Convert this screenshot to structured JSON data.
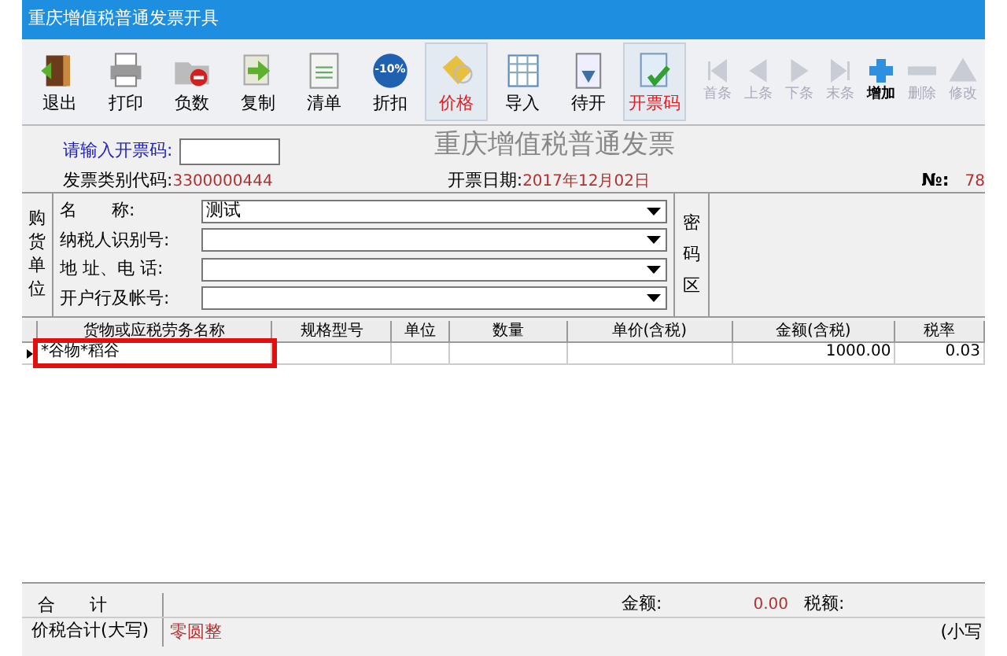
{
  "window": {
    "title": "重庆增值税普通发票开具"
  },
  "toolbar": [
    {
      "label": "退出",
      "kind": "exit",
      "active": false,
      "disabled": false
    },
    {
      "label": "打印",
      "kind": "print",
      "active": false,
      "disabled": false
    },
    {
      "label": "负数",
      "kind": "negative",
      "active": false,
      "disabled": false
    },
    {
      "label": "复制",
      "kind": "copy",
      "active": false,
      "disabled": false
    },
    {
      "label": "清单",
      "kind": "list",
      "active": false,
      "disabled": false
    },
    {
      "label": "折扣",
      "kind": "discount",
      "icon_text": "-10%",
      "active": false,
      "disabled": false
    },
    {
      "label": "价格",
      "kind": "price",
      "active": true,
      "disabled": false
    },
    {
      "label": "导入",
      "kind": "import",
      "active": false,
      "disabled": false
    },
    {
      "label": "待开",
      "kind": "pending",
      "active": false,
      "disabled": false
    },
    {
      "label": "开票码",
      "kind": "code",
      "active": true,
      "disabled": false
    }
  ],
  "nav": [
    {
      "label": "首条",
      "kind": "first",
      "disabled": true
    },
    {
      "label": "上条",
      "kind": "prev",
      "disabled": true
    },
    {
      "label": "下条",
      "kind": "next",
      "disabled": true
    },
    {
      "label": "末条",
      "kind": "last",
      "disabled": true
    },
    {
      "label": "增加",
      "kind": "add",
      "disabled": false
    },
    {
      "label": "删除",
      "kind": "remove",
      "disabled": true
    },
    {
      "label": "修改",
      "kind": "edit",
      "disabled": true
    }
  ],
  "invoice": {
    "heading": "重庆增值税普通发票",
    "code_prompt": "请输入开票码:",
    "type_code_label": "发票类别代码:",
    "type_code": "3300000444",
    "date_label": "开票日期:",
    "date": "2017年12月02日",
    "no_label": "№:",
    "no": "78"
  },
  "buyer": {
    "side_label": "购货单位",
    "fields": [
      {
        "label": "名　　称:",
        "value": "测试"
      },
      {
        "label": "纳税人识别号:"
      },
      {
        "label": "地 址、电 话:"
      },
      {
        "label": "开户行及帐号:"
      }
    ],
    "cipher_label": "密码区"
  },
  "table": {
    "columns": [
      "货物或应税劳务名称",
      "规格型号",
      "单位",
      "数量",
      "单价(含税)",
      "金额(含税)",
      "税率"
    ],
    "rows": [
      {
        "cells": [
          "*谷物*稻谷",
          null,
          null,
          null,
          null,
          "1000.00",
          "0.03"
        ],
        "highlighted": true
      }
    ]
  },
  "totals": {
    "sum_label": "合　　计",
    "amount_label": "金额:",
    "amount": "0.00",
    "tax_label": "税额:",
    "words_label": "价税合计(大写)",
    "words": "零圆整",
    "small_label": "(小写"
  }
}
